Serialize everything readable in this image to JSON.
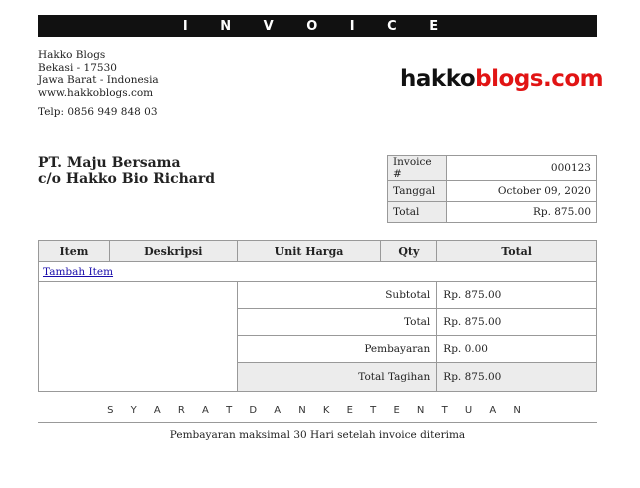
{
  "banner": {
    "title": "I N V O I C E"
  },
  "company": {
    "name": "Hakko Blogs",
    "address_line1": "Bekasi - 17530",
    "address_line2": "Jawa Barat - Indonesia",
    "website": "www.hakkoblogs.com",
    "phone": "Telp: 0856 949 848 03"
  },
  "logo": {
    "part1": "hakko",
    "part2": "blogs.com",
    "color1": "#111111",
    "color2": "#e11414"
  },
  "client": {
    "name": "PT. Maju Bersama",
    "contact": "c/o Hakko Bio Richard"
  },
  "meta": [
    {
      "label": "Invoice #",
      "value": "000123"
    },
    {
      "label": "Tanggal",
      "value": "October 09, 2020"
    },
    {
      "label": "Total",
      "value": "Rp. 875.00"
    }
  ],
  "items": {
    "columns": [
      "Item",
      "Deskripsi",
      "Unit Harga",
      "Qty",
      "Total"
    ],
    "add_item_link": "Tambah Item"
  },
  "summary": [
    {
      "label": "Subtotal",
      "value": "Rp. 875.00"
    },
    {
      "label": "Total",
      "value": "Rp. 875.00"
    },
    {
      "label": "Pembayaran",
      "value": "Rp. 0.00"
    },
    {
      "label": "Total Tagihan",
      "value": "Rp. 875.00"
    }
  ],
  "terms": {
    "title": "S Y A R A T   D A N   K E T E N T U A N",
    "text": "Pembayaran maksimal 30 Hari setelah invoice diterima"
  }
}
